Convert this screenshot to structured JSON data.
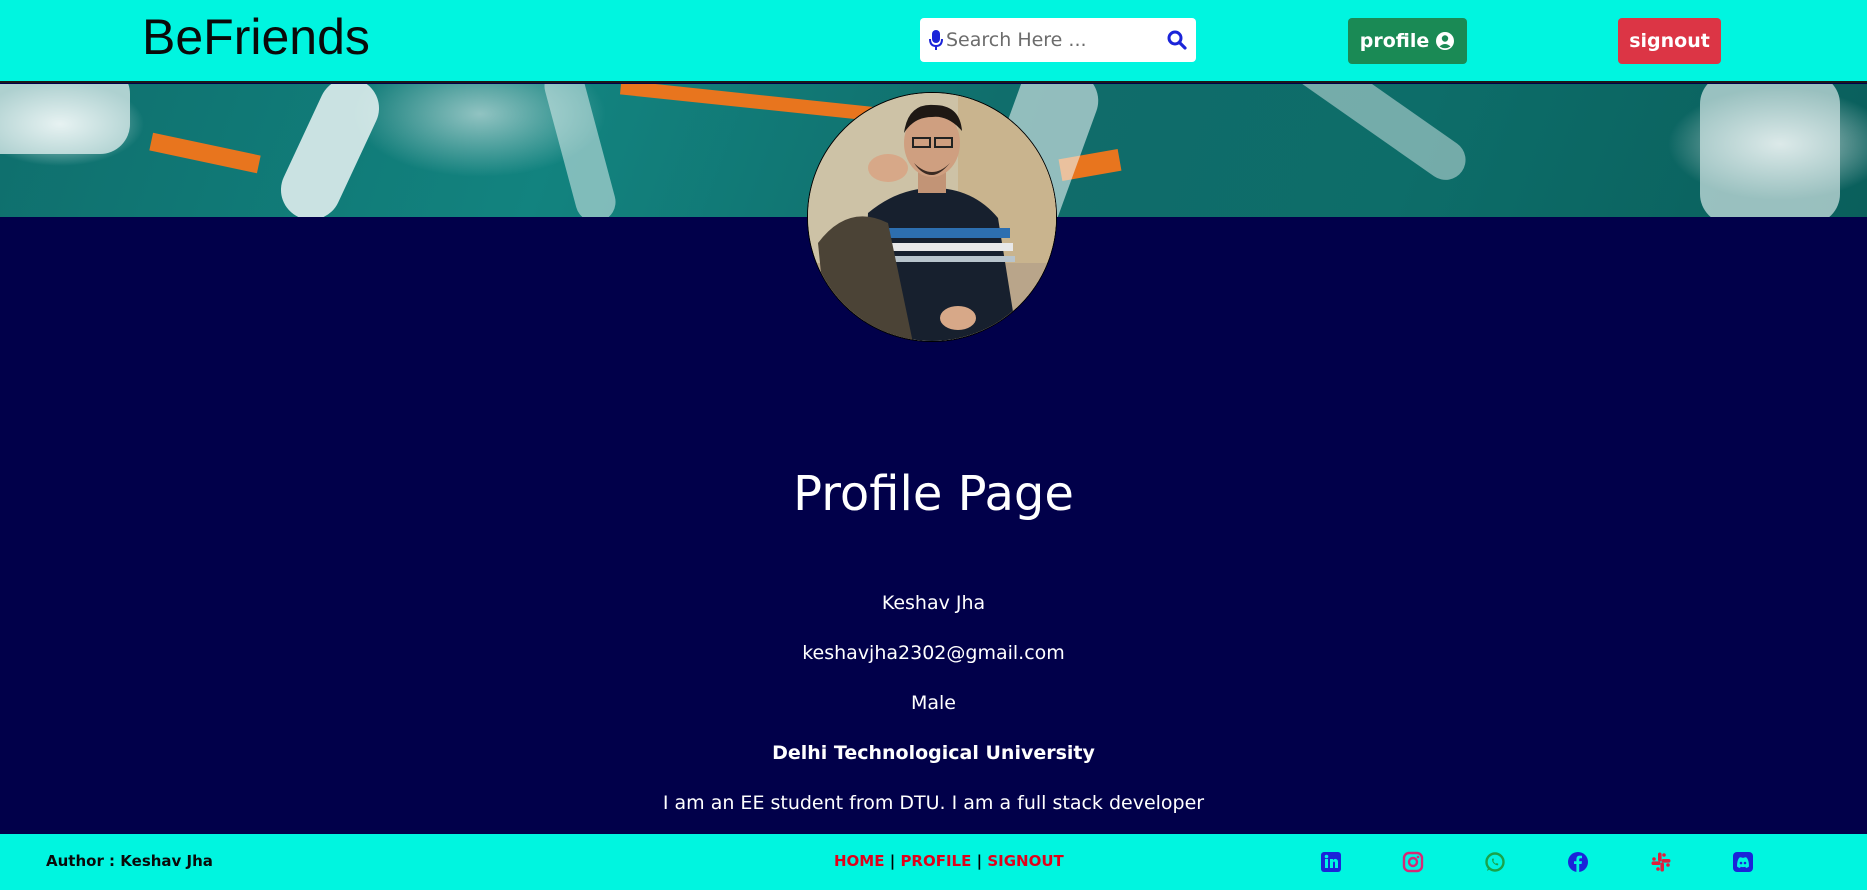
{
  "navbar": {
    "brand": "BeFriends",
    "search": {
      "placeholder": "Search Here ..."
    },
    "profile_label": "profile",
    "signout_label": "signout"
  },
  "profile": {
    "title": "Profile Page",
    "name": "Keshav Jha",
    "email": "keshavjha2302@gmail.com",
    "gender": "Male",
    "college": "Delhi Technological University",
    "bio": "I am an EE student from DTU. I am a full stack developer"
  },
  "footer": {
    "author": "Author : Keshav Jha",
    "links": [
      "HOME",
      "PROFILE",
      "SIGNOUT"
    ],
    "separator": "|",
    "social_icons": [
      "linkedin-icon",
      "instagram-icon",
      "whatsapp-icon",
      "facebook-icon",
      "slack-icon",
      "discord-icon"
    ]
  },
  "colors": {
    "navbar_bg": "#00f5e0",
    "page_bg": "#01004a",
    "profile_button": "#1a8a55",
    "signout_button": "#dc3545",
    "footer_link": "#e0001a"
  }
}
